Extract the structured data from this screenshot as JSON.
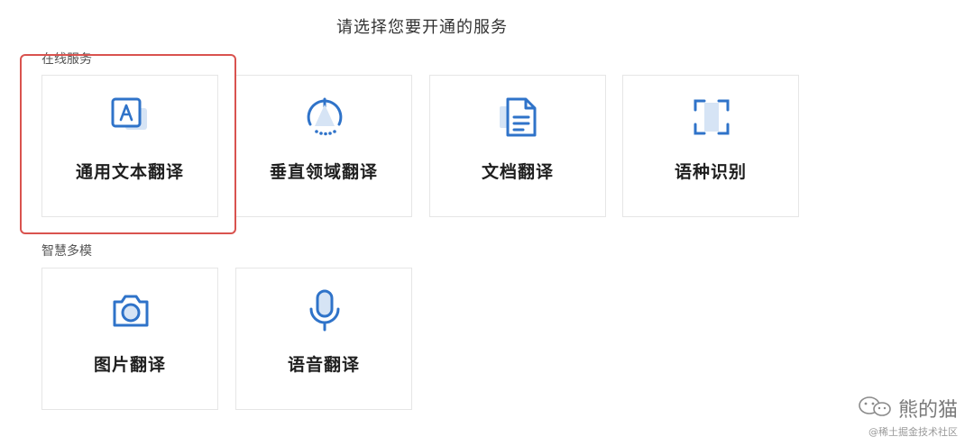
{
  "page": {
    "title": "请选择您要开通的服务"
  },
  "sections": [
    {
      "label": "在线服务",
      "cards": [
        {
          "label": "通用文本翻译",
          "icon": "text-translate-icon"
        },
        {
          "label": "垂直领域翻译",
          "icon": "domain-translate-icon"
        },
        {
          "label": "文档翻译",
          "icon": "document-icon"
        },
        {
          "label": "语种识别",
          "icon": "scan-frame-icon"
        }
      ]
    },
    {
      "label": "智慧多模",
      "cards": [
        {
          "label": "图片翻译",
          "icon": "camera-icon"
        },
        {
          "label": "语音翻译",
          "icon": "microphone-icon"
        }
      ]
    }
  ],
  "watermark": {
    "name": "熊的猫",
    "sub": "@稀土掘金技术社区",
    "icon": "wechat-icon"
  },
  "colors": {
    "accent": "#2f73c9",
    "accent_light": "#d6e4f5",
    "highlight": "#d9534f"
  }
}
